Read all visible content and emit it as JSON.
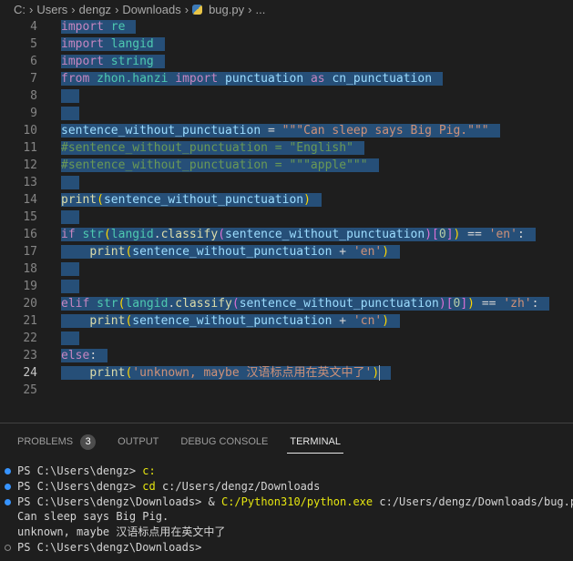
{
  "breadcrumb": {
    "items": [
      "C:",
      "Users",
      "dengz",
      "Downloads",
      "bug.py",
      "..."
    ],
    "file_icon": "python-icon"
  },
  "editor": {
    "current_line": 24,
    "lines": [
      {
        "n": 4,
        "t": [
          [
            "import",
            "kw"
          ],
          [
            " ",
            ""
          ],
          [
            "re",
            "mod"
          ]
        ]
      },
      {
        "n": 5,
        "t": [
          [
            "import",
            "kw"
          ],
          [
            " ",
            ""
          ],
          [
            "langid",
            "mod"
          ]
        ]
      },
      {
        "n": 6,
        "t": [
          [
            "import",
            "kw"
          ],
          [
            " ",
            ""
          ],
          [
            "string",
            "mod"
          ]
        ]
      },
      {
        "n": 7,
        "t": [
          [
            "from",
            "kw"
          ],
          [
            " ",
            ""
          ],
          [
            "zhon.hanzi",
            "mod"
          ],
          [
            " ",
            ""
          ],
          [
            "import",
            "kw"
          ],
          [
            " ",
            ""
          ],
          [
            "punctuation",
            "var"
          ],
          [
            " ",
            ""
          ],
          [
            "as",
            "kw"
          ],
          [
            " ",
            ""
          ],
          [
            "cn_punctuation",
            "var"
          ]
        ]
      },
      {
        "n": 8,
        "t": []
      },
      {
        "n": 9,
        "t": []
      },
      {
        "n": 10,
        "t": [
          [
            "sentence_without_punctuation",
            "var"
          ],
          [
            " = ",
            "op"
          ],
          [
            "\"\"\"Can sleep says Big Pig.\"\"\"",
            "str"
          ]
        ]
      },
      {
        "n": 11,
        "t": [
          [
            "#sentence_without_punctuation = \"English\"",
            "cm"
          ]
        ]
      },
      {
        "n": 12,
        "t": [
          [
            "#sentence_without_punctuation = \"\"\"apple\"\"\"",
            "cm"
          ]
        ]
      },
      {
        "n": 13,
        "t": []
      },
      {
        "n": 14,
        "t": [
          [
            "print",
            "fn"
          ],
          [
            "(",
            "b1"
          ],
          [
            "sentence_without_punctuation",
            "var"
          ],
          [
            ")",
            "b1"
          ]
        ]
      },
      {
        "n": 15,
        "t": []
      },
      {
        "n": 16,
        "t": [
          [
            "if",
            "kw"
          ],
          [
            " ",
            ""
          ],
          [
            "str",
            "mod"
          ],
          [
            "(",
            "b1"
          ],
          [
            "langid",
            "mod"
          ],
          [
            ".",
            ""
          ],
          [
            "classify",
            "fn"
          ],
          [
            "(",
            "b2"
          ],
          [
            "sentence_without_punctuation",
            "var"
          ],
          [
            ")",
            "b2"
          ],
          [
            "[",
            "b2"
          ],
          [
            "0",
            "num"
          ],
          [
            "]",
            "b2"
          ],
          [
            ")",
            "b1"
          ],
          [
            " == ",
            "op"
          ],
          [
            "'en'",
            "str"
          ],
          [
            ":",
            ""
          ]
        ]
      },
      {
        "n": 17,
        "t": [
          [
            "    ",
            ""
          ],
          [
            "print",
            "fn"
          ],
          [
            "(",
            "b1"
          ],
          [
            "sentence_without_punctuation",
            "var"
          ],
          [
            " + ",
            "op"
          ],
          [
            "'en'",
            "str"
          ],
          [
            ")",
            "b1"
          ]
        ]
      },
      {
        "n": 18,
        "t": []
      },
      {
        "n": 19,
        "t": []
      },
      {
        "n": 20,
        "t": [
          [
            "elif",
            "kw"
          ],
          [
            " ",
            ""
          ],
          [
            "str",
            "mod"
          ],
          [
            "(",
            "b1"
          ],
          [
            "langid",
            "mod"
          ],
          [
            ".",
            ""
          ],
          [
            "classify",
            "fn"
          ],
          [
            "(",
            "b2"
          ],
          [
            "sentence_without_punctuation",
            "var"
          ],
          [
            ")",
            "b2"
          ],
          [
            "[",
            "b2"
          ],
          [
            "0",
            "num"
          ],
          [
            "]",
            "b2"
          ],
          [
            ")",
            "b1"
          ],
          [
            " == ",
            "op"
          ],
          [
            "'zh'",
            "str"
          ],
          [
            ":",
            ""
          ]
        ]
      },
      {
        "n": 21,
        "t": [
          [
            "    ",
            ""
          ],
          [
            "print",
            "fn"
          ],
          [
            "(",
            "b1"
          ],
          [
            "sentence_without_punctuation",
            "var"
          ],
          [
            " + ",
            "op"
          ],
          [
            "'cn'",
            "str"
          ],
          [
            ")",
            "b1"
          ]
        ]
      },
      {
        "n": 22,
        "t": []
      },
      {
        "n": 23,
        "t": [
          [
            "else",
            "kw"
          ],
          [
            ":",
            ""
          ]
        ]
      },
      {
        "n": 24,
        "t": [
          [
            "    ",
            ""
          ],
          [
            "print",
            "fn"
          ],
          [
            "(",
            "b1"
          ],
          [
            "'unknown, maybe 汉语标点用在英文中了'",
            "str"
          ],
          [
            ")",
            "b1"
          ]
        ]
      },
      {
        "n": 25,
        "t": [],
        "unselected": true
      }
    ]
  },
  "panel": {
    "tabs": [
      {
        "label": "PROBLEMS",
        "badge": "3"
      },
      {
        "label": "OUTPUT"
      },
      {
        "label": "DEBUG CONSOLE"
      },
      {
        "label": "TERMINAL",
        "active": true
      }
    ]
  },
  "terminal": {
    "lines": [
      {
        "dot": "filled",
        "t": [
          [
            "PS C:\\Users\\dengz> ",
            ""
          ],
          [
            "c:",
            "ty"
          ]
        ]
      },
      {
        "dot": "filled",
        "t": [
          [
            "PS C:\\Users\\dengz> ",
            ""
          ],
          [
            "cd",
            "ty"
          ],
          [
            " c:/Users/dengz/Downloads",
            ""
          ]
        ]
      },
      {
        "dot": "filled",
        "t": [
          [
            "PS C:\\Users\\dengz\\Downloads> & ",
            ""
          ],
          [
            "C:/Python310/python.exe",
            "ty"
          ],
          [
            " c:/Users/dengz/Downloads/bug.py",
            ""
          ]
        ]
      },
      {
        "dot": "",
        "t": [
          [
            "Can sleep says Big Pig.",
            ""
          ]
        ]
      },
      {
        "dot": "",
        "t": [
          [
            "unknown, maybe 汉语标点用在英文中了",
            ""
          ]
        ]
      },
      {
        "dot": "empty",
        "t": [
          [
            "PS C:\\Users\\dengz\\Downloads>",
            ""
          ]
        ]
      }
    ]
  }
}
